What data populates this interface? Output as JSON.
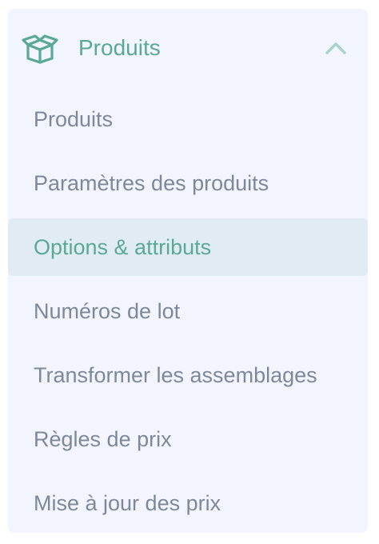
{
  "accent_color": "#5aa996",
  "text_color": "#7f8899",
  "section": {
    "icon": "box-icon",
    "label": "Produits",
    "toggle_icon": "chevron-up-icon",
    "expanded": true
  },
  "menu": {
    "items": [
      {
        "label": "Produits",
        "active": false
      },
      {
        "label": "Paramètres des produits",
        "active": false
      },
      {
        "label": "Options & attributs",
        "active": true
      },
      {
        "label": "Numéros de lot",
        "active": false
      },
      {
        "label": "Transformer les assemblages",
        "active": false
      },
      {
        "label": "Règles de prix",
        "active": false
      },
      {
        "label": "Mise à jour des prix",
        "active": false
      }
    ]
  }
}
